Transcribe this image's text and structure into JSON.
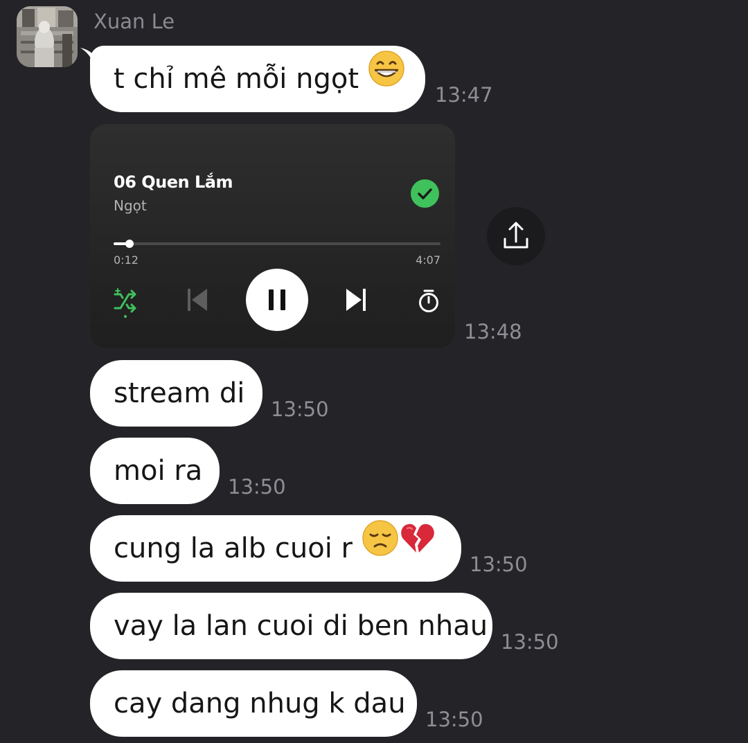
{
  "chat": {
    "sender_name": "Xuan Le"
  },
  "messages": [
    {
      "text": "t chỉ mê mỗi ngọt",
      "emoji": [
        "grinning-face"
      ],
      "time": "13:47"
    },
    {
      "text": "stream di",
      "time": "13:50"
    },
    {
      "text": "moi ra",
      "time": "13:50"
    },
    {
      "text": "cung la alb cuoi r",
      "emoji": [
        "disappointed-face",
        "broken-heart"
      ],
      "time": "13:50"
    },
    {
      "text": "vay la lan cuoi di ben nhau",
      "time": "13:50"
    },
    {
      "text": "cay dang nhug k dau",
      "time": "13:50"
    }
  ],
  "player": {
    "track_title": "06 Quen Lắm",
    "artist": "Ngọt",
    "elapsed": "0:12",
    "duration": "4:07",
    "progress_fraction": 0.049,
    "saved": true,
    "time": "13:48",
    "icons": [
      "shuffle-icon",
      "previous-icon",
      "pause-icon",
      "next-icon",
      "sleep-timer-icon",
      "check-icon"
    ]
  },
  "share": {
    "icon": "share-upload-icon"
  },
  "colors": {
    "background": "#242428",
    "bubble": "#ffffff",
    "accent_green": "#3fc15c",
    "timestamp": "#8e8e94"
  }
}
